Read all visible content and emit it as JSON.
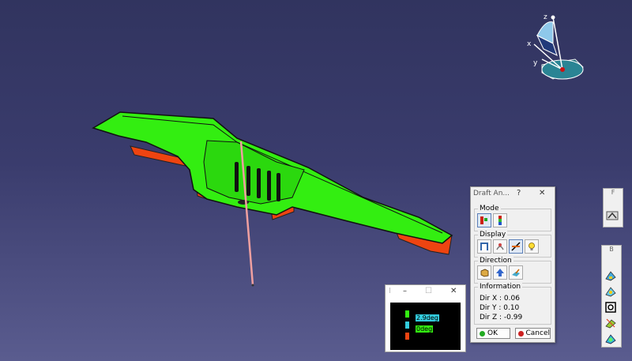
{
  "compass": {
    "z_label": "z",
    "x_label": "x",
    "y_label": "y"
  },
  "draft_dialog": {
    "title": "Draft An...",
    "help": "?",
    "close": "✕",
    "mode_label": "Mode",
    "display_label": "Display",
    "direction_label": "Direction",
    "information_label": "Information",
    "dir_x": "Dir X : 0.06",
    "dir_y": "Dir Y : 0.10",
    "dir_z": "Dir Z : -0.99",
    "ok_label": "OK",
    "cancel_label": "Cancel"
  },
  "color_scale": {
    "title": "I",
    "minimize": "–",
    "maximize": "☐",
    "close": "✕",
    "upper_value": "2.9deg",
    "lower_value": "0deg"
  },
  "toolbar_top": {
    "label": "F"
  },
  "toolbar_bottom": {
    "label": "B"
  },
  "colors": {
    "green": "#33ee11",
    "cyan": "#33ccdd",
    "red": "#ee4411",
    "background": "#3a3c6d"
  }
}
